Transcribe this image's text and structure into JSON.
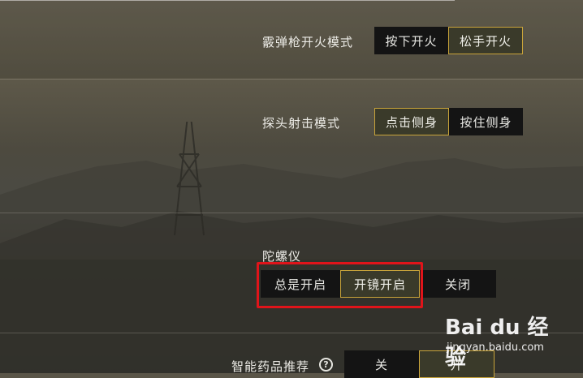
{
  "settings": {
    "shotgun": {
      "label": "霰弹枪开火模式",
      "options": [
        "按下开火",
        "松手开火"
      ],
      "selected": 1
    },
    "peek": {
      "label": "探头射击模式",
      "options": [
        "点击侧身",
        "按住侧身"
      ],
      "selected": 0
    },
    "gyro": {
      "label": "陀螺仪",
      "options": [
        "总是开启",
        "开镜开启",
        "关闭"
      ],
      "selected": 1
    },
    "smart_meds": {
      "label": "智能药品推荐",
      "help_icon": "question-circle-icon",
      "options": [
        "关",
        "开"
      ],
      "selected": 1
    }
  },
  "highlight": {
    "color": "#e0141a"
  },
  "accent_color": "#c9a43a",
  "watermark": {
    "logo": "Bai du 经验",
    "site": "jingyan.baidu.com"
  }
}
